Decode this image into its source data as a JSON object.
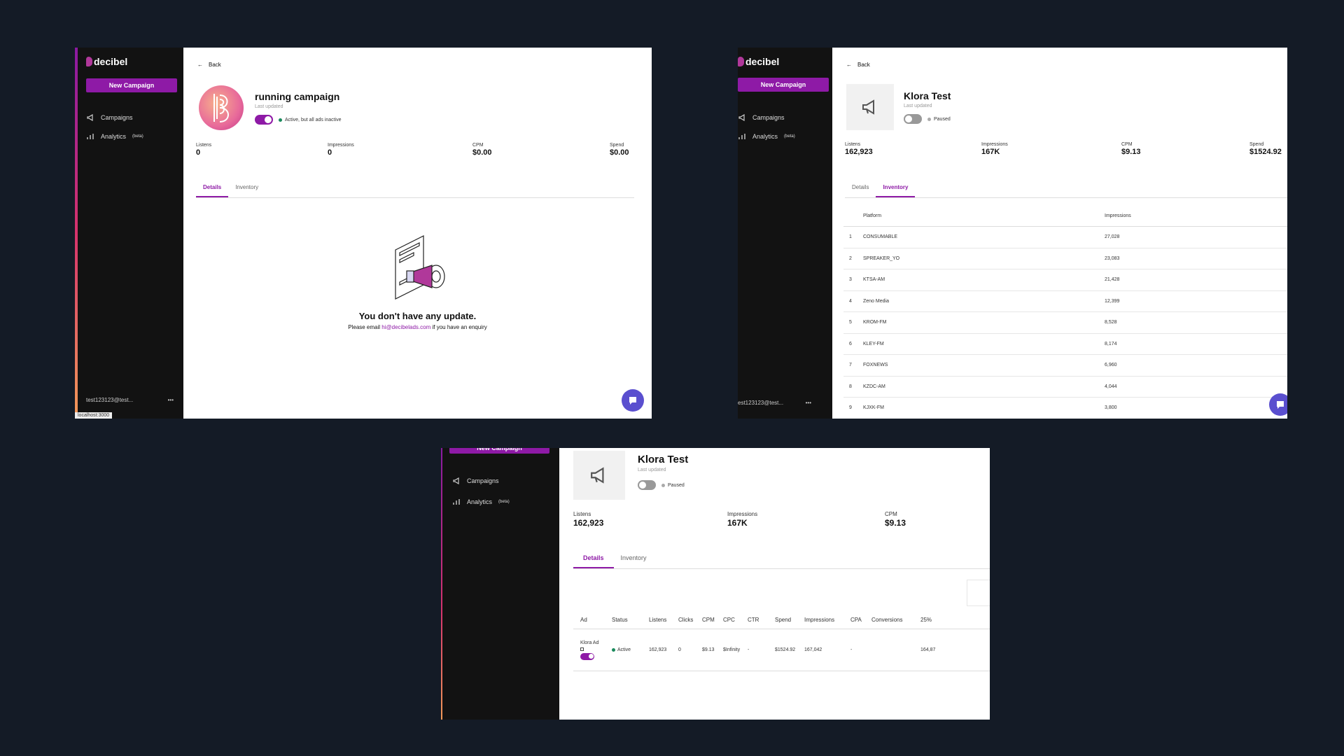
{
  "brand": {
    "name": "decibel",
    "new_campaign": "New Campaign"
  },
  "nav": {
    "campaigns": "Campaigns",
    "analytics": "Analytics",
    "analytics_tag": "(beta)"
  },
  "colors": {
    "accent": "#8e1aa6",
    "background": "#141b26",
    "sidebar": "#121212",
    "active_dot": "#1a8a5c"
  },
  "shot1": {
    "back": "Back",
    "title": "running campaign",
    "last_updated": "Last updated",
    "toggle_on": true,
    "status": "Active, but all ads inactive",
    "stats": [
      {
        "label": "Listens",
        "value": "0"
      },
      {
        "label": "Impressions",
        "value": "0"
      },
      {
        "label": "CPM",
        "value": "$0.00"
      },
      {
        "label": "Spend",
        "value": "$0.00"
      }
    ],
    "tabs": [
      "Details",
      "Inventory"
    ],
    "empty_title": "You don't have any update.",
    "empty_prefix": "Please email",
    "empty_email": "hi@decibelads.com",
    "empty_suffix": "if you have an enquiry",
    "user": "test123123@test...",
    "url_tip": "localhost:3000"
  },
  "shot2": {
    "back": "Back",
    "title": "Klora Test",
    "last_updated": "Last updated",
    "toggle_on": false,
    "status": "Paused",
    "stats": [
      {
        "label": "Listens",
        "value": "162,923"
      },
      {
        "label": "Impressions",
        "value": "167K"
      },
      {
        "label": "CPM",
        "value": "$9.13"
      },
      {
        "label": "Spend",
        "value": "$1524.92"
      }
    ],
    "tabs": [
      "Details",
      "Inventory"
    ],
    "table_headers": [
      "Platform",
      "Impressions"
    ],
    "rows": [
      {
        "i": "1",
        "platform": "CONSUMABLE",
        "impressions": "27,028"
      },
      {
        "i": "2",
        "platform": "SPREAKER_YO",
        "impressions": "23,083"
      },
      {
        "i": "3",
        "platform": "KTSA-AM",
        "impressions": "21,428"
      },
      {
        "i": "4",
        "platform": "Zeno Media",
        "impressions": "12,399"
      },
      {
        "i": "5",
        "platform": "KROM-FM",
        "impressions": "8,528"
      },
      {
        "i": "6",
        "platform": "KLEY-FM",
        "impressions": "8,174"
      },
      {
        "i": "7",
        "platform": "FOXNEWS",
        "impressions": "6,960"
      },
      {
        "i": "8",
        "platform": "KZDC-AM",
        "impressions": "4,044"
      },
      {
        "i": "9",
        "platform": "KJXK-FM",
        "impressions": "3,800"
      }
    ],
    "user": "est123123@test..."
  },
  "shot3": {
    "new_campaign": "New Campaign",
    "title": "Klora Test",
    "last_updated": "Last updated",
    "status": "Paused",
    "stats": [
      {
        "label": "Listens",
        "value": "162,923"
      },
      {
        "label": "Impressions",
        "value": "167K"
      },
      {
        "label": "CPM",
        "value": "$9.13"
      }
    ],
    "tabs": [
      "Details",
      "Inventory"
    ],
    "headers": [
      "Ad",
      "Status",
      "Listens",
      "Clicks",
      "CPM",
      "CPC",
      "CTR",
      "Spend",
      "Impressions",
      "CPA",
      "Conversions",
      "25%"
    ],
    "row": {
      "ad": "Klora Ad",
      "status": "Active",
      "listens": "162,923",
      "clicks": "0",
      "cpm": "$9.13",
      "cpc": "$Infinity",
      "ctr": "-",
      "spend": "$1524.92",
      "impressions": "167,042",
      "cpa": "-",
      "conversions": "",
      "q25": "164,87"
    }
  }
}
